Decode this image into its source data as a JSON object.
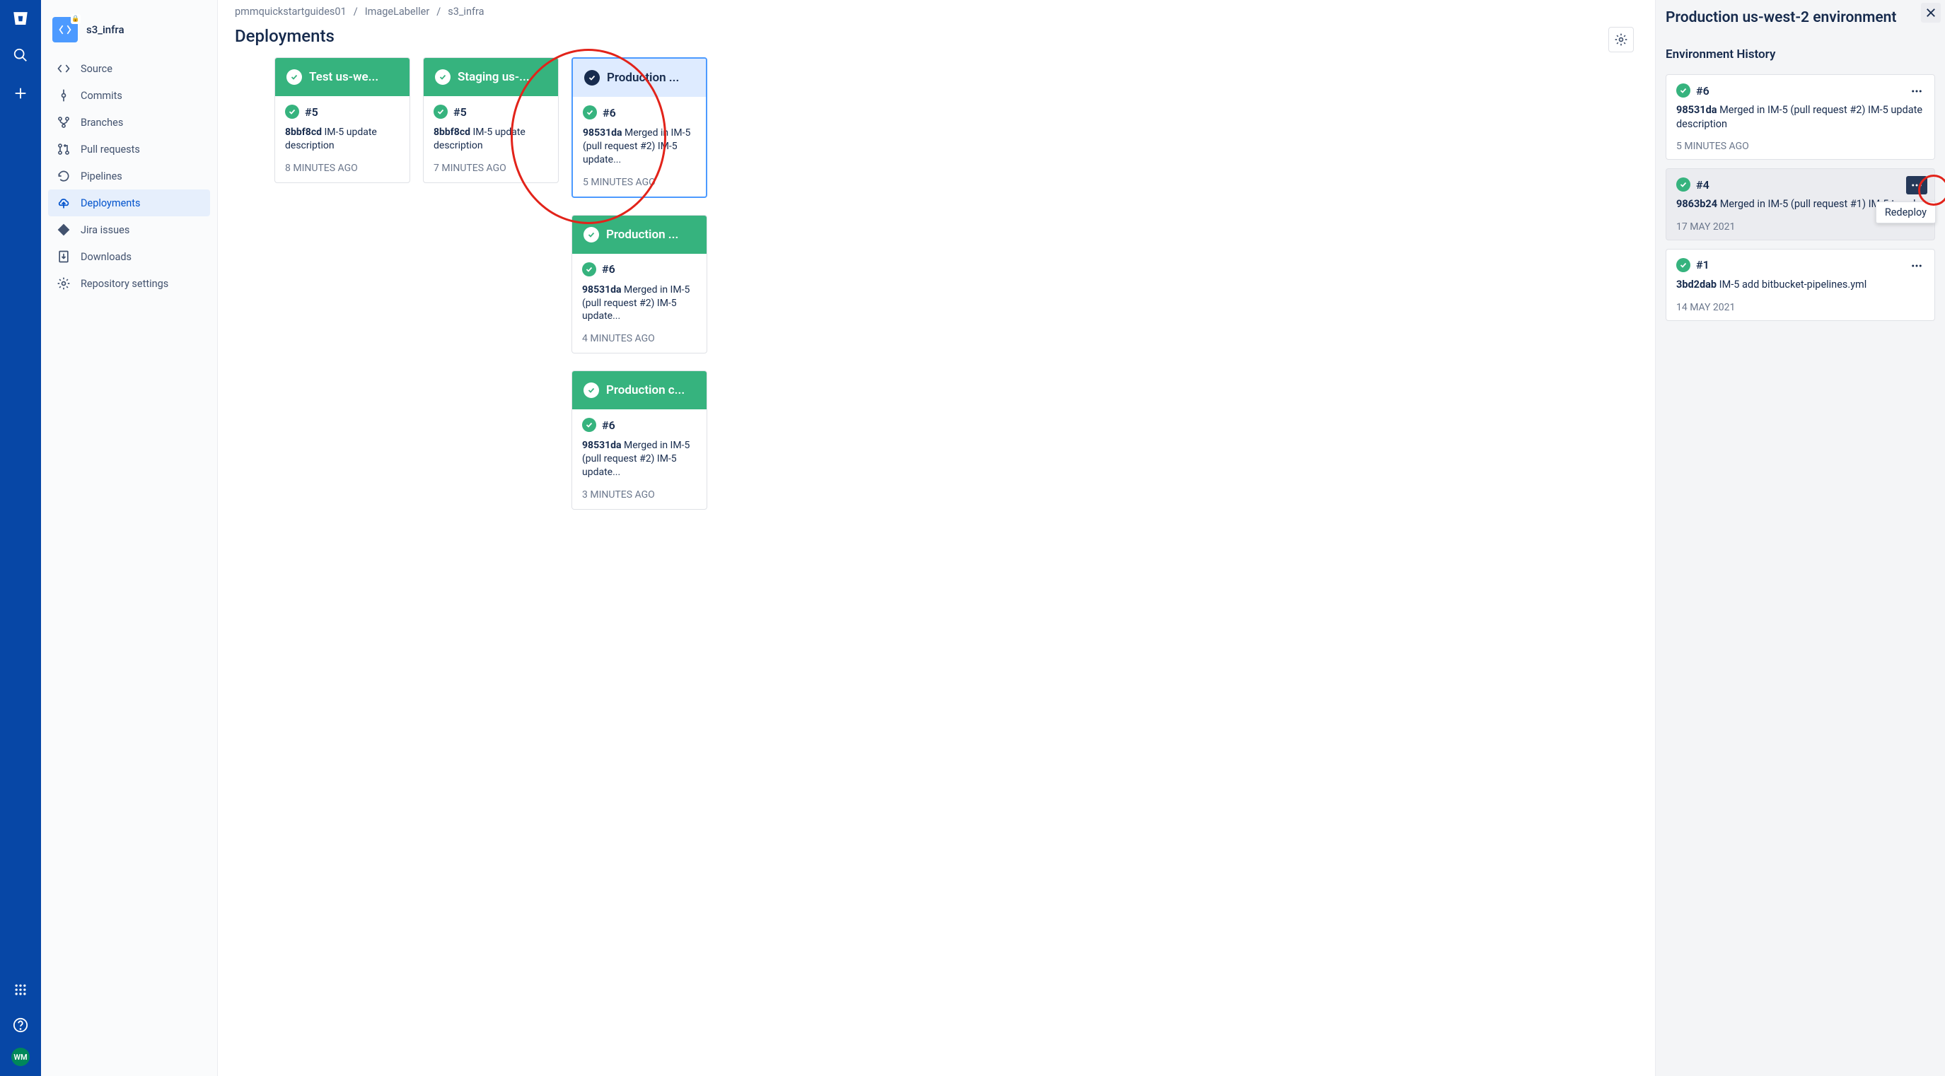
{
  "rail": {
    "avatar": "WM"
  },
  "repo": {
    "name": "s3_infra"
  },
  "sidebar": {
    "items": [
      {
        "label": "Source"
      },
      {
        "label": "Commits"
      },
      {
        "label": "Branches"
      },
      {
        "label": "Pull requests"
      },
      {
        "label": "Pipelines"
      },
      {
        "label": "Deployments"
      },
      {
        "label": "Jira issues"
      },
      {
        "label": "Downloads"
      },
      {
        "label": "Repository settings"
      }
    ]
  },
  "breadcrumbs": [
    "pmmquickstartguides01",
    "ImageLabeller",
    "s3_infra"
  ],
  "page_title": "Deployments",
  "envs": [
    {
      "col": 0,
      "selected": false,
      "header_style": "green",
      "header": "Test us-we...",
      "build": "#5",
      "hash": "8bbf8cd",
      "msg": "IM-5 update description",
      "time": "8 MINUTES AGO"
    },
    {
      "col": 1,
      "selected": false,
      "header_style": "green",
      "header": "Staging us-...",
      "build": "#5",
      "hash": "8bbf8cd",
      "msg": "IM-5 update description",
      "time": "7 MINUTES AGO"
    },
    {
      "col": 2,
      "selected": true,
      "header_style": "selected",
      "header": "Production ...",
      "build": "#6",
      "hash": "98531da",
      "msg": "Merged in IM-5 (pull request #2) IM-5 update...",
      "time": "5 MINUTES AGO"
    },
    {
      "col": 2,
      "selected": false,
      "header_style": "green",
      "header": "Production ...",
      "build": "#6",
      "hash": "98531da",
      "msg": "Merged in IM-5 (pull request #2) IM-5 update...",
      "time": "4 MINUTES AGO"
    },
    {
      "col": 2,
      "selected": false,
      "header_style": "green",
      "header": "Production c...",
      "build": "#6",
      "hash": "98531da",
      "msg": "Merged in IM-5 (pull request #2) IM-5 update...",
      "time": "3 MINUTES AGO"
    }
  ],
  "panel": {
    "title": "Production us-west-2 environment",
    "subtitle": "Environment History",
    "tooltip": "Redeploy",
    "history": [
      {
        "build": "#6",
        "hash": "98531da",
        "msg": "Merged in IM-5 (pull request #2) IM-5 update description",
        "time": "5 MINUTES AGO",
        "hovered": false
      },
      {
        "build": "#4",
        "hash": "9863b24",
        "msg": "Merged in IM-5 (pull request #1) IM-5 tweak",
        "time": "17 MAY 2021",
        "hovered": true
      },
      {
        "build": "#1",
        "hash": "3bd2dab",
        "msg": "IM-5 add bitbucket-pipelines.yml",
        "time": "14 MAY 2021",
        "hovered": false
      }
    ]
  }
}
